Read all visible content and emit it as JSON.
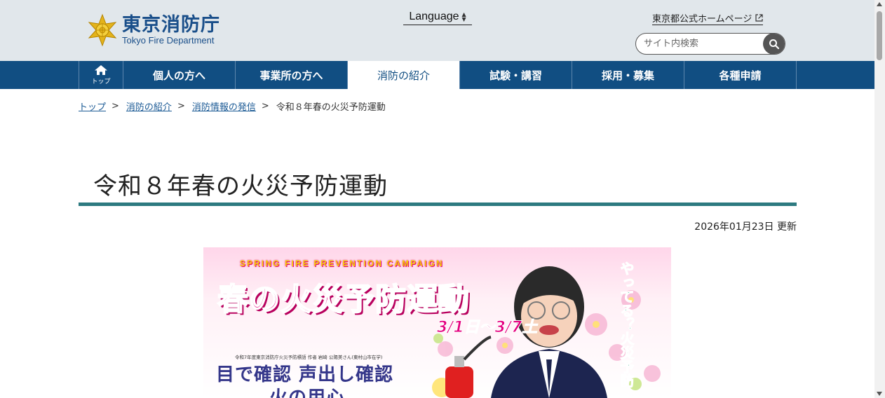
{
  "header": {
    "logo_jp": "東京消防庁",
    "logo_en": "Tokyo Fire Department",
    "language_label": "Language",
    "tmg_link": "東京都公式ホームページ",
    "search_placeholder": "サイト内検索"
  },
  "nav": {
    "home_label": "トップ",
    "items": [
      "個人の方へ",
      "事業所の方へ",
      "消防の紹介",
      "試験・講習",
      "採用・募集",
      "各種申請"
    ],
    "active_index": 2
  },
  "breadcrumb": {
    "links": [
      "トップ",
      "消防の紹介",
      "消防情報の発信"
    ],
    "current": "令和８年春の火災予防運動"
  },
  "page": {
    "title": "令和８年春の火災予防運動",
    "updated": "2026年01月23日 更新"
  },
  "banner": {
    "english": "SPRING FIRE PREVENTION CAMPAIGN",
    "title": "春の火災予防運動",
    "dates": "3/1日～3/7土",
    "slogan_sub": "令和7年度東京消防庁火災予防標語 作者 岩崎 公陽美さん(東村山市在学)",
    "slogan_line1": "目で確認 声出し確認",
    "slogan_line2": "火の用心",
    "side_text": "やってる？火災予防"
  },
  "colors": {
    "header_bg": "#e1e7eb",
    "nav_bg": "#114e82",
    "title_rule": "#2d7a80",
    "link": "#1b5a95"
  }
}
